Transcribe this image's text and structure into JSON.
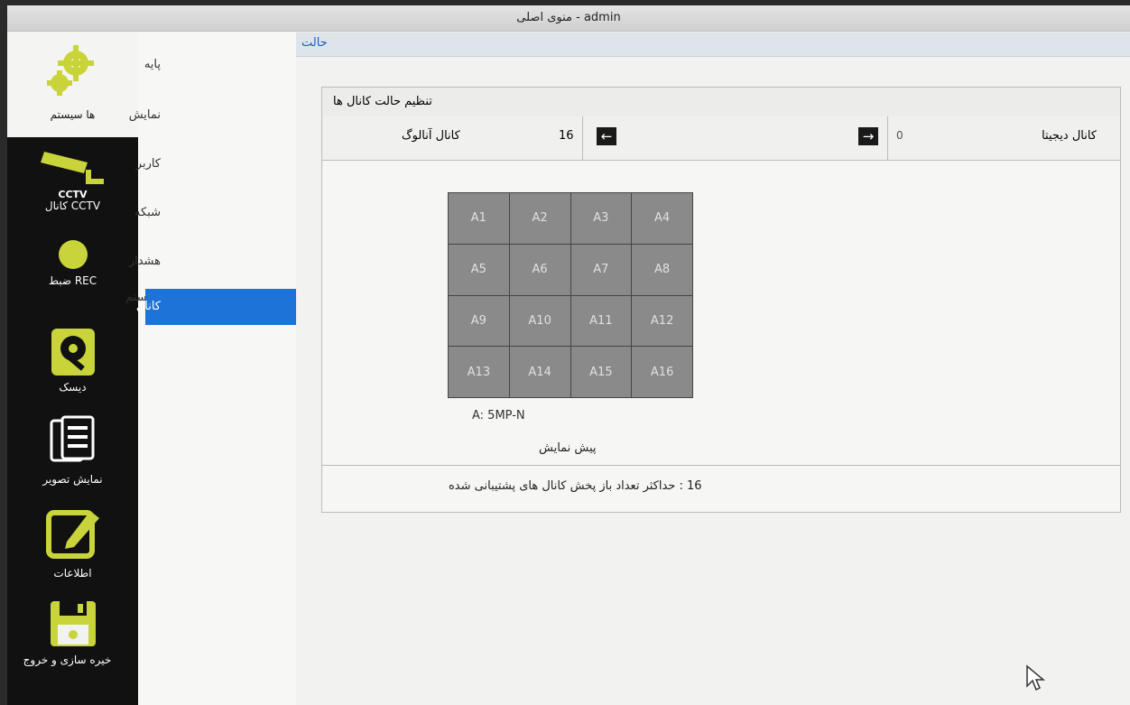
{
  "window": {
    "title": "منوی اصلی - admin"
  },
  "toolbar": [
    {
      "label": "ها سیستم",
      "icon": "gears-icon"
    },
    {
      "label": "CCTV کانال",
      "icon": "cctv-camera-icon"
    },
    {
      "label": "REC ضبط",
      "icon": "record-icon"
    },
    {
      "label": "دیسک",
      "icon": "disk-icon"
    },
    {
      "label": "نمایش تصویر",
      "icon": "documents-icon"
    },
    {
      "label": "اطلاعات",
      "icon": "edit-icon"
    },
    {
      "label": "خیره سازی و خروج",
      "icon": "floppy-icon"
    }
  ],
  "submenu": [
    {
      "label": "پایه"
    },
    {
      "label": "نمایش"
    },
    {
      "label": "کاربر"
    },
    {
      "label": "شبکه"
    },
    {
      "label": "هشدار سیستم"
    },
    {
      "label": "کانال",
      "selected": true
    }
  ],
  "main": {
    "tab": "حالت",
    "panel_title": "تنظیم حالت کانال ها",
    "analog_label": "کانال آنالوگ",
    "analog_count": "16",
    "digital_label": "کانال دیجیتا",
    "digital_count": "0",
    "left_arrow": "←",
    "right_arrow": "→",
    "channels": [
      "A1",
      "A2",
      "A3",
      "A4",
      "A5",
      "A6",
      "A7",
      "A8",
      "A9",
      "A10",
      "A11",
      "A12",
      "A13",
      "A14",
      "A15",
      "A16"
    ],
    "legend": "A:  5MP-N",
    "preview_label": "پیش نمایش",
    "footer": "16 : حداکثر تعداد باز پخش کانال های پشتیبانی شده"
  },
  "colors": {
    "accent": "#1e73d8",
    "toolbar_bg": "#111111",
    "icon_lime": "#c8d43a"
  }
}
